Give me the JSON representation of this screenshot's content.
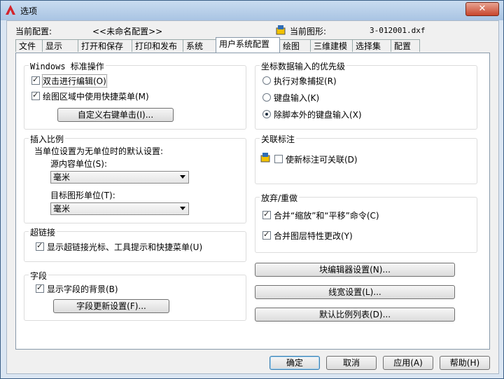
{
  "window": {
    "title": "选项",
    "close_label": "✕"
  },
  "header": {
    "profile_label": "当前配置:",
    "profile_value": "<<未命名配置>>",
    "drawing_label": "当前图形:",
    "drawing_value": "3-012001.dxf"
  },
  "tabs": [
    {
      "label": "文件"
    },
    {
      "label": "显示"
    },
    {
      "label": "打开和保存"
    },
    {
      "label": "打印和发布"
    },
    {
      "label": "系统"
    },
    {
      "label": "用户系统配置"
    },
    {
      "label": "绘图"
    },
    {
      "label": "三维建模"
    },
    {
      "label": "选择集"
    },
    {
      "label": "配置"
    }
  ],
  "windows_group": {
    "title": "Windows 标准操作",
    "double_click_label": "双击进行编辑(O)",
    "double_click_checked": true,
    "shortcut_label": "绘图区域中使用快捷菜单(M)",
    "shortcut_checked": true,
    "right_click_button": "自定义右键单击(I)..."
  },
  "insert_group": {
    "title": "插入比例",
    "subtitle": "当单位设置为无单位时的默认设置:",
    "source_label": "源内容单位(S):",
    "source_value": "毫米",
    "target_label": "目标图形单位(T):",
    "target_value": "毫米"
  },
  "hyperlink_group": {
    "title": "超链接",
    "label": "显示超链接光标、工具提示和快捷菜单(U)",
    "checked": true
  },
  "field_group": {
    "title": "字段",
    "label": "显示字段的背景(B)",
    "checked": true,
    "button": "字段更新设置(F)..."
  },
  "coord_group": {
    "title": "坐标数据输入的优先级",
    "options": [
      {
        "label": "执行对象捕捉(R)",
        "checked": false
      },
      {
        "label": "键盘输入(K)",
        "checked": false
      },
      {
        "label": "除脚本外的键盘输入(X)",
        "checked": true
      }
    ]
  },
  "assoc_group": {
    "title": "关联标注",
    "label": "使新标注可关联(D)",
    "checked": false
  },
  "undo_group": {
    "title": "放弃/重做",
    "combine_zoom_label": "合并“缩放”和“平移”命令(C)",
    "combine_zoom_checked": true,
    "combine_layer_label": "合并图层特性更改(Y)",
    "combine_layer_checked": true
  },
  "right_buttons": {
    "block_editor": "块编辑器设置(N)...",
    "lineweight": "线宽设置(L)...",
    "scale_list": "默认比例列表(D)..."
  },
  "footer": {
    "ok": "确定",
    "cancel": "取消",
    "apply": "应用(A)",
    "help": "帮助(H)"
  },
  "colors": {
    "accent": "#3c7fb1",
    "title_bar": "#a9c4e3",
    "close": "#c8462d"
  }
}
